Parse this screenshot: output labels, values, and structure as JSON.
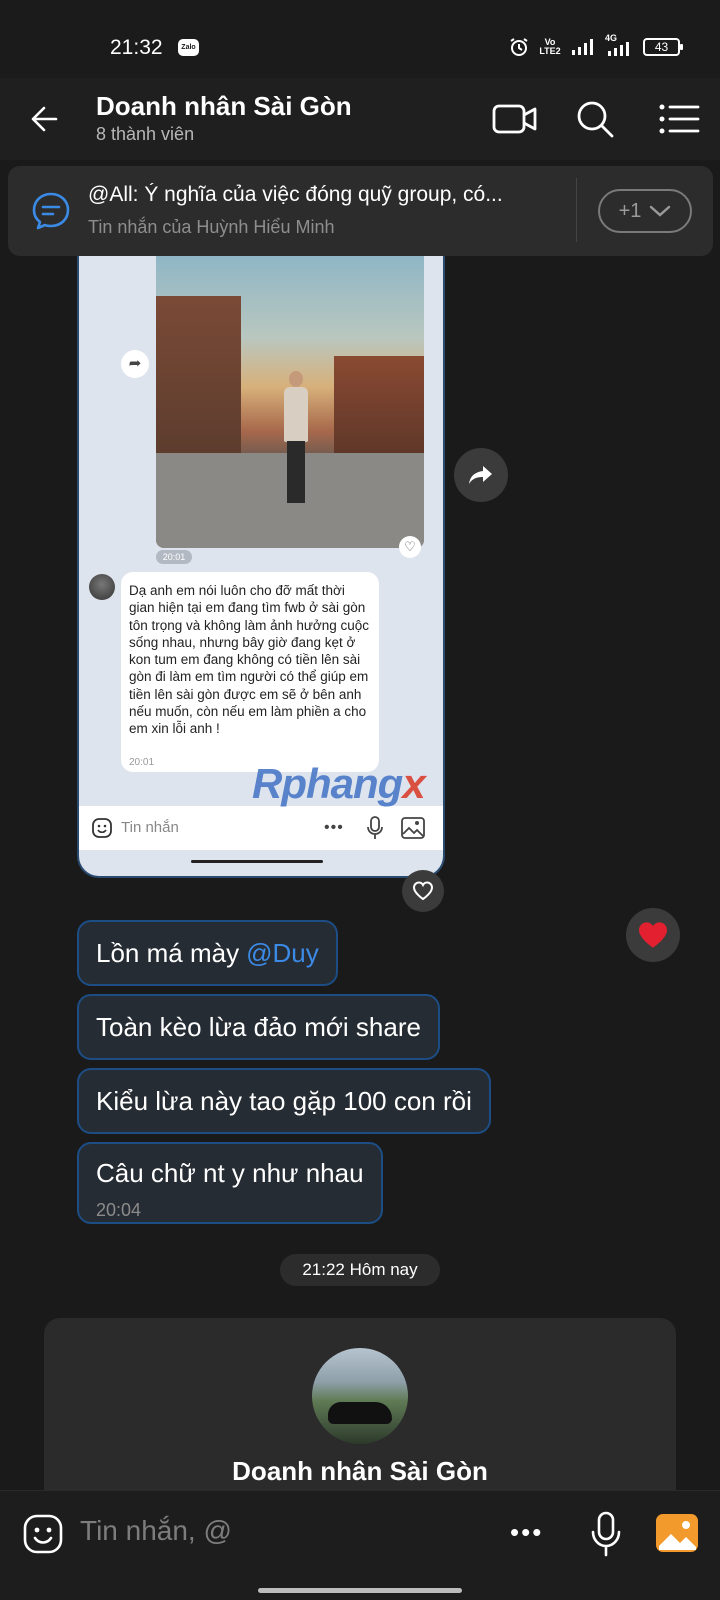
{
  "status_bar": {
    "time": "21:32",
    "app_badge": "Zalo",
    "volte": "Vo LTE2",
    "network": "4G",
    "battery": "43"
  },
  "header": {
    "title": "Doanh nhân Sài Gòn",
    "subtitle": "8 thành viên"
  },
  "pinned": {
    "title": "@All: Ý nghĩa của việc đóng quỹ group, có...",
    "subtitle": "Tin nhắn của Huỳnh Hiểu Minh",
    "more": "+1"
  },
  "screenshot": {
    "photo_time": "20:01",
    "message": "Dạ anh em nói luôn cho đỡ mất thời gian hiện tại em đang tìm fwb ở sài gòn tôn trọng và không làm ảnh hưởng cuộc sống nhau, nhưng bây giờ đang kẹt ở kon tum em đang không có tiền lên sài gòn đi làm em tìm người có thể giúp em tiền lên sài gòn được em sẽ ở bên anh nếu muốn, còn nếu em làm phiền a cho em xin lỗi anh !",
    "message_time": "20:01",
    "input_placeholder": "Tin nhắn"
  },
  "watermark": {
    "main": "Rphang",
    "accent": "x"
  },
  "messages": [
    {
      "text": "Lồn má mày",
      "mention": "@Duy"
    },
    {
      "text": "Toàn kèo lừa đảo mới share"
    },
    {
      "text": "Kiểu lừa này tao gặp 100 con rồi"
    },
    {
      "text": "Câu chữ nt y như nhau",
      "time": "20:04"
    }
  ],
  "divider": {
    "text": "21:22 Hôm nay"
  },
  "group_card": {
    "name": "Doanh nhân Sài Gòn"
  },
  "input": {
    "placeholder": "Tin nhắn, @"
  },
  "icons": {
    "back": "arrow-left-icon",
    "video": "video-call-icon",
    "search": "search-icon",
    "menu": "list-menu-icon",
    "pinned": "pinned-message-icon",
    "forward": "forward-icon",
    "heart": "heart-icon",
    "reaction": "red-heart-icon",
    "sticker": "sticker-icon",
    "more": "more-dots-icon",
    "mic": "microphone-icon",
    "image": "image-icon"
  },
  "colors": {
    "accent": "#3b8ae6",
    "bubble_border": "#1c4d84",
    "reaction_red": "#e3202f",
    "image_orange": "#f39a2c"
  }
}
